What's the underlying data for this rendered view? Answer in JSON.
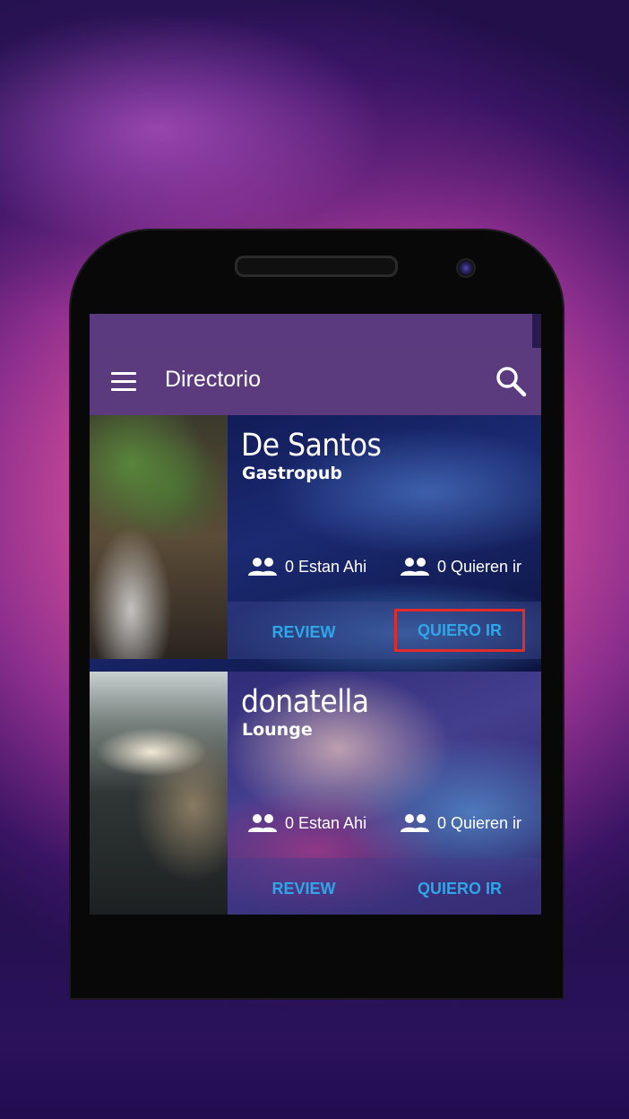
{
  "app": {
    "title": "Directorio"
  },
  "icons": {
    "menu": "hamburger-menu-icon",
    "search": "search-icon",
    "people": "people-icon"
  },
  "colors": {
    "app_bar": "#5b3a7e",
    "button_text": "#2ea6e8",
    "highlight": "#e52a2a"
  },
  "venues": [
    {
      "name": "De Santos",
      "type": "Gastropub",
      "stat_here": "0 Estan Ahi",
      "stat_want": "0 Quieren ir",
      "review_label": "REVIEW",
      "quiero_label": "QUIERO IR",
      "quiero_highlighted": true
    },
    {
      "name": "donatella",
      "type": "Lounge",
      "stat_here": "0 Estan Ahi",
      "stat_want": "0 Quieren ir",
      "review_label": "REVIEW",
      "quiero_label": "QUIERO IR",
      "quiero_highlighted": false
    }
  ]
}
